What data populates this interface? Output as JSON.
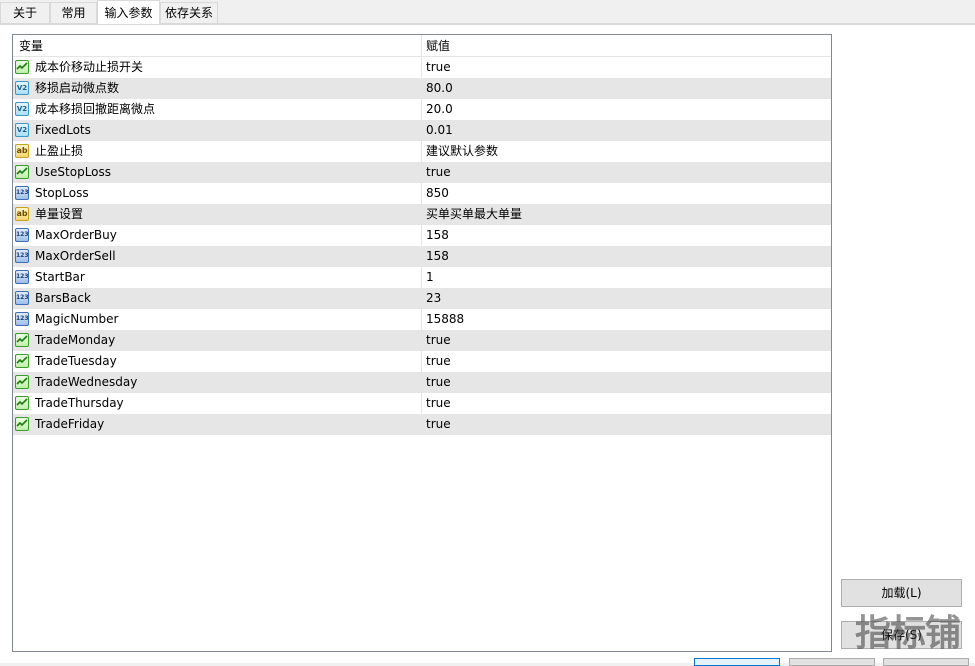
{
  "tabs": [
    {
      "label": "关于"
    },
    {
      "label": "常用"
    },
    {
      "label": "输入参数"
    },
    {
      "label": "依存关系"
    }
  ],
  "table": {
    "col_variable": "变量",
    "col_value": "赋值",
    "rows": [
      {
        "type": "bool",
        "name": "成本价移动止损开关",
        "value": "true"
      },
      {
        "type": "double",
        "icon_text": "V2",
        "name": "移损启动微点数",
        "value": "80.0"
      },
      {
        "type": "double",
        "icon_text": "V2",
        "name": "成本移损回撤距离微点",
        "value": "20.0"
      },
      {
        "type": "double",
        "icon_text": "V2",
        "name": "FixedLots",
        "value": "0.01"
      },
      {
        "type": "string",
        "icon_text": "ab",
        "name": "止盈止损",
        "value": "建议默认参数"
      },
      {
        "type": "bool",
        "name": "UseStopLoss",
        "value": "true"
      },
      {
        "type": "int",
        "icon_text": "123",
        "name": "StopLoss",
        "value": "850"
      },
      {
        "type": "string",
        "icon_text": "ab",
        "name": "单量设置",
        "value": "买单买单最大单量"
      },
      {
        "type": "int",
        "icon_text": "123",
        "name": "MaxOrderBuy",
        "value": "158"
      },
      {
        "type": "int",
        "icon_text": "123",
        "name": "MaxOrderSell",
        "value": "158"
      },
      {
        "type": "int",
        "icon_text": "123",
        "name": "StartBar",
        "value": "1"
      },
      {
        "type": "int",
        "icon_text": "123",
        "name": "BarsBack",
        "value": "23"
      },
      {
        "type": "int",
        "icon_text": "123",
        "name": "MagicNumber",
        "value": "15888"
      },
      {
        "type": "bool",
        "name": "TradeMonday",
        "value": "true"
      },
      {
        "type": "bool",
        "name": "TradeTuesday",
        "value": "true"
      },
      {
        "type": "bool",
        "name": "TradeWednesday",
        "value": "true"
      },
      {
        "type": "bool",
        "name": "TradeThursday",
        "value": "true"
      },
      {
        "type": "bool",
        "name": "TradeFriday",
        "value": "true"
      }
    ]
  },
  "buttons": {
    "load": "加载(L)",
    "save": "保存(S)"
  },
  "watermark": "指标铺",
  "colors": {
    "row_alt": "#e6e6e6",
    "bool_icon": "#3c9b2c",
    "double_icon": "#3f97c4",
    "int_icon": "#3e6db5",
    "string_icon": "#c7a21e"
  }
}
